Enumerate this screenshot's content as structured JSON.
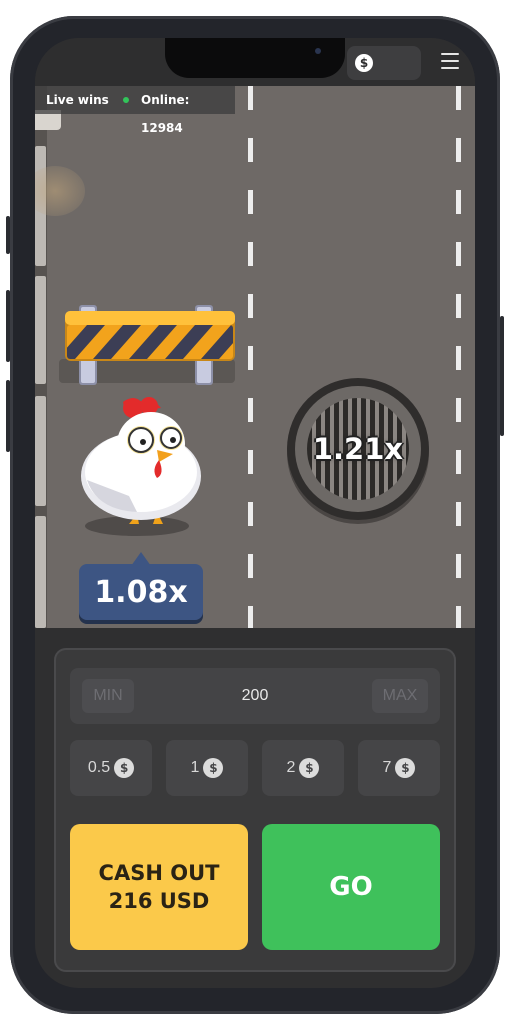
{
  "header": {
    "balance_currency_icon": "dollar-coin-icon",
    "balance_currency_symbol": "$",
    "menu_icon": "hamburger-menu-icon"
  },
  "info_bar": {
    "live_wins_label": "Live wins",
    "online_label": "Online: 12984",
    "online_dot_color": "#32c45a"
  },
  "game": {
    "current_multiplier": "1.08x",
    "next_multiplier": "1.21x",
    "road_color": "#6e6966"
  },
  "controls": {
    "min_label": "MIN",
    "max_label": "MAX",
    "bet_amount": "200",
    "quick_bets": [
      {
        "amount": "0.5",
        "icon": "dollar-coin-icon",
        "symbol": "$"
      },
      {
        "amount": "1",
        "icon": "dollar-coin-icon",
        "symbol": "$"
      },
      {
        "amount": "2",
        "icon": "dollar-coin-icon",
        "symbol": "$"
      },
      {
        "amount": "7",
        "icon": "dollar-coin-icon",
        "symbol": "$"
      }
    ],
    "cashout_line1": "CASH OUT",
    "cashout_line2": "216 USD",
    "go_label": "GO",
    "cashout_color": "#fbc94a",
    "go_color": "#3fc15b"
  }
}
